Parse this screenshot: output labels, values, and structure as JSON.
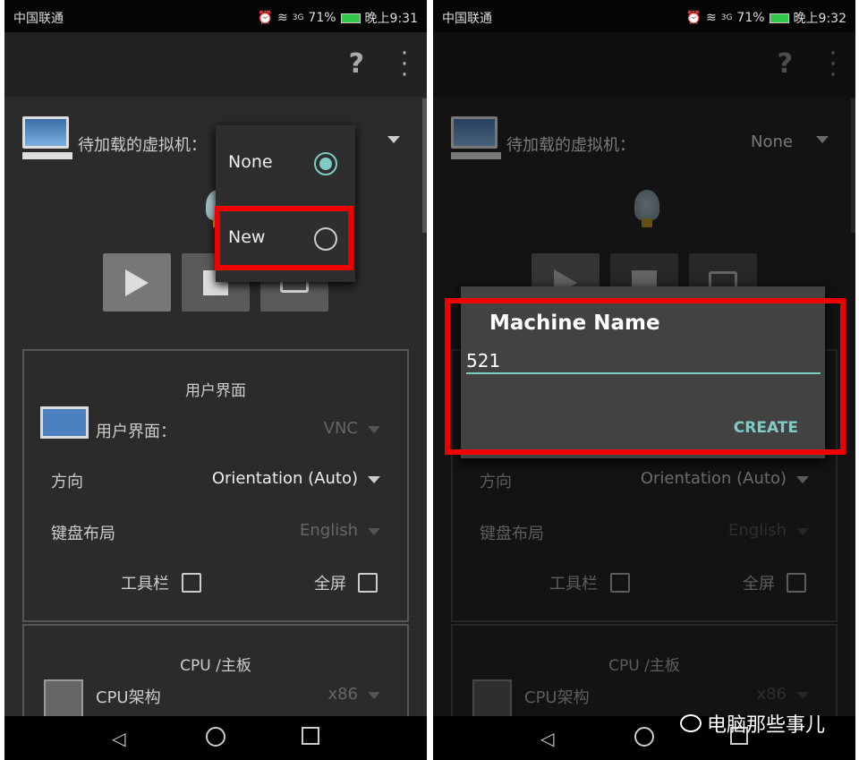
{
  "status": {
    "carrier": "中国联通",
    "network": "3G",
    "battery": "71%",
    "time_left": "晚上9:31",
    "time_right": "晚上9:32"
  },
  "toolbar": {
    "help": "?",
    "more": "⋮"
  },
  "vm": {
    "label": "待加载的虚拟机：",
    "value": "None"
  },
  "popup": {
    "options": [
      {
        "label": "None",
        "selected": true
      },
      {
        "label": "New",
        "selected": false
      }
    ]
  },
  "ui_section": {
    "title": "用户界面",
    "ui_label": "用户界面：",
    "ui_value": "VNC",
    "orientation_label": "方向",
    "orientation_value": "Orientation (Auto)",
    "keyboard_label": "键盘布局",
    "keyboard_value": "English",
    "toolbar_label": "工具栏",
    "fullscreen_label": "全屏",
    "toolbar_checked": false,
    "fullscreen_checked": false
  },
  "cpu_section": {
    "title": "CPU /主板",
    "arch_label": "CPU架构",
    "arch_value": "x86"
  },
  "dialog": {
    "title": "Machine Name",
    "value": "521",
    "create": "CREATE"
  },
  "watermark": "电脑那些事儿",
  "colors": {
    "accent": "#80cbc4",
    "highlight": "#e00000"
  }
}
